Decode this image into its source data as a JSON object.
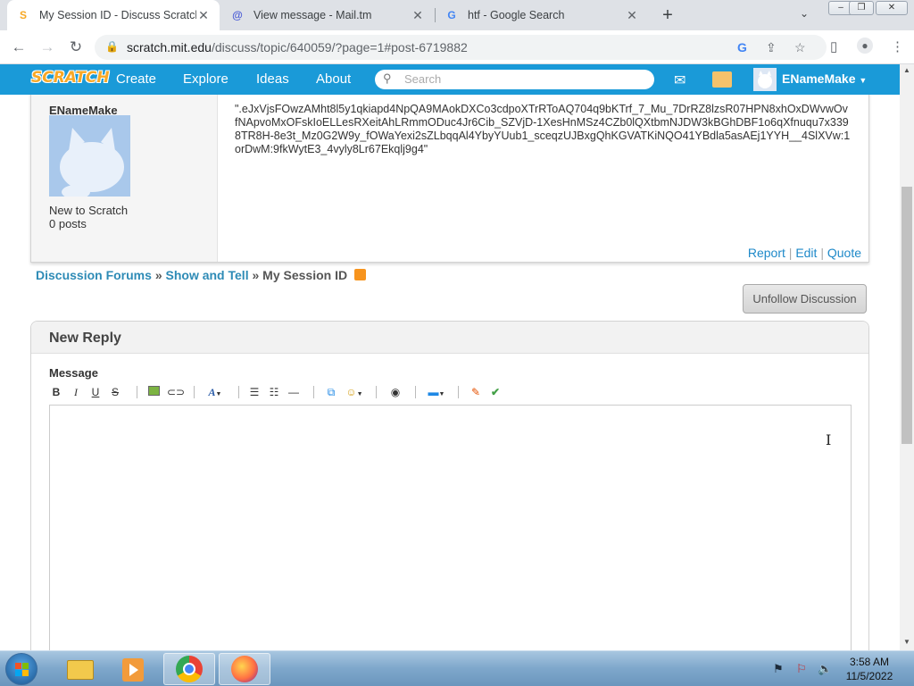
{
  "browser": {
    "tabs": [
      {
        "title": "My Session ID - Discuss Scratch",
        "favicon": "scratch-favicon",
        "active": true
      },
      {
        "title": "View message - Mail.tm",
        "favicon": "mailtm-favicon",
        "active": false
      },
      {
        "title": "htf - Google Search",
        "favicon": "google-favicon",
        "active": false
      }
    ],
    "new_tab_label": "+",
    "url_host": "scratch.mit.edu",
    "url_path": "/discuss/topic/640059/?page=1#post-6719882"
  },
  "scratch_nav": {
    "logo": "SCRATCH",
    "links": [
      "Create",
      "Explore",
      "Ideas",
      "About"
    ],
    "search_placeholder": "Search",
    "username": "ENameMake"
  },
  "post": {
    "author": "ENameMake",
    "rank": "New to Scratch",
    "posts": "0 posts",
    "body": "\".eJxVjsFOwzAMht8l5y1qkiapd4NpQA9MAokDXCo3cdpoXTrRToAQ704q9bKTrf_7_Mu_7DrRZ8lzsR07HPN8xhOxDWvwOvfNApvoMxOFskIoELLesRXeitAhLRmmODuc4Jr6Cib_SZVjD-1XesHnMSz4CZb0lQXtbmNJDW3kBGhDBF1o6qXfnuqu7x3398TR8H-8e3t_Mz0G2W9y_fOWaYexi2sZLbqqAl4YbyYUub1_sceqzUJBxgQhKGVATKiNQO41YBdla5asAEj1YYH__4SlXVw:1orDwM:9fkWytE3_4vyly8Lr67Ekqlj9g4\"",
    "actions": [
      "Report",
      "Edit",
      "Quote"
    ],
    "action_separator": "|"
  },
  "breadcrumb": {
    "items": [
      "Discussion Forums",
      "Show and Tell"
    ],
    "separator": "»",
    "current": "My Session ID"
  },
  "unfollow_label": "Unfollow Discussion",
  "reply": {
    "title": "New Reply",
    "message_label": "Message",
    "toolbar_icons": [
      "bold-icon",
      "italic-icon",
      "underline-icon",
      "strikethrough-icon",
      "image-icon",
      "link-icon",
      "font-color-icon",
      "bulleted-list-icon",
      "numbered-list-icon",
      "horizontal-rule-icon",
      "scratchblocks-icon",
      "smiley-icon",
      "globe-icon",
      "code-icon",
      "clean-icon",
      "check-icon"
    ],
    "toolbar_labels": {
      "bold": "B",
      "italic": "I",
      "underline": "U",
      "strike": "S",
      "font": "A"
    },
    "editor_value": ""
  },
  "taskbar": {
    "clock_time": "3:58 AM",
    "clock_date": "11/5/2022",
    "apps": [
      "explorer",
      "media-player",
      "chrome",
      "firefox"
    ]
  },
  "colors": {
    "scratch_blue": "#1a9ad8",
    "link_blue": "#1e89c9",
    "breadcrumb_blue": "#2e8bb6"
  }
}
